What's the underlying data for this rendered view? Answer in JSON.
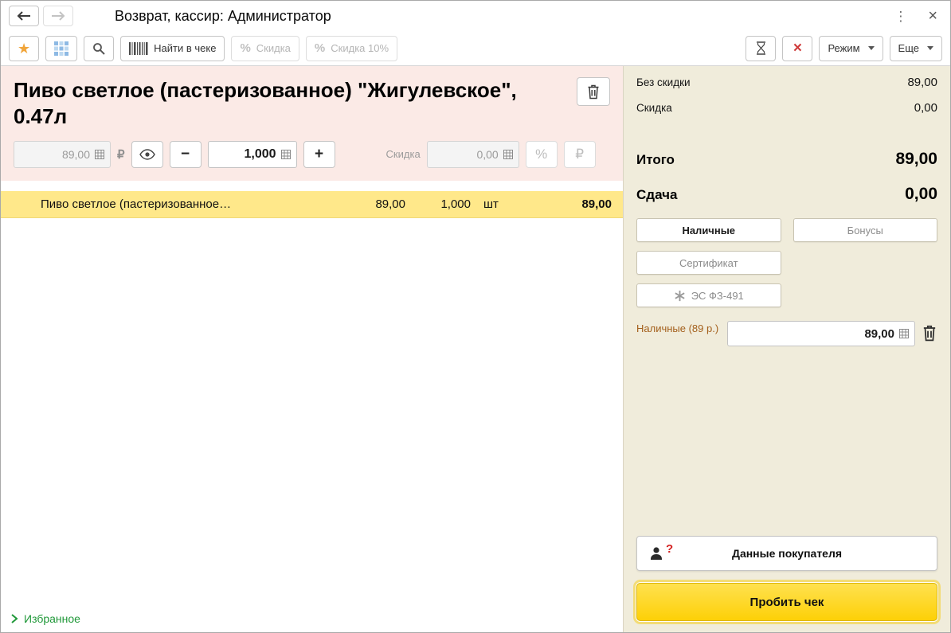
{
  "colors": {
    "accent_yellow": "#fdd007",
    "selected_row_yellow": "#ffe88a",
    "product_panel_pink": "#fbeae6",
    "summary_panel_beige": "#f0ecdb",
    "favorites_green": "#1f9838",
    "star_orange": "#f1a53a",
    "alert_red": "#d42222",
    "cash_label_brown": "#a35f1b"
  },
  "icons": {
    "star": "★",
    "percent": "%",
    "close": "×",
    "menu_dots": "⋮",
    "cancel_x": "×",
    "minus": "−",
    "plus": "+",
    "ruble": "₽",
    "question": "?"
  },
  "titlebar": {
    "title": "Возврат, кассир: Администратор"
  },
  "toolbar": {
    "find_in_receipt_label": "Найти в чеке",
    "discount_label": "Скидка",
    "discount10_label": "Скидка 10%",
    "mode_label": "Режим",
    "more_label": "Еще"
  },
  "product": {
    "title": "Пиво светлое (пастеризованное) \"Жигулевское\", 0.47л",
    "price_value": "89,00",
    "currency": "₽",
    "qty_value": "1,000",
    "discount_label": "Скидка",
    "discount_value": "0,00"
  },
  "receipt": {
    "rows": [
      {
        "name": "Пиво светлое (пастеризованное…",
        "price": "89,00",
        "qty": "1,000",
        "unit": "шт",
        "total": "89,00"
      }
    ]
  },
  "favorites_label": "Избранное",
  "summary": {
    "no_discount_label": "Без скидки",
    "no_discount_value": "89,00",
    "discount_label": "Скидка",
    "discount_value": "0,00",
    "total_label": "Итого",
    "total_value": "89,00",
    "change_label": "Сдача",
    "change_value": "0,00",
    "cash_label": "Наличные",
    "bonus_label": "Бонусы",
    "certificate_label": "Сертификат",
    "es_label": "ЭС ФЗ-491",
    "cash_line_label": "Наличные (89 р.)",
    "cash_line_value": "89,00",
    "customer_label": "Данные покупателя",
    "submit_label": "Пробить чек"
  }
}
